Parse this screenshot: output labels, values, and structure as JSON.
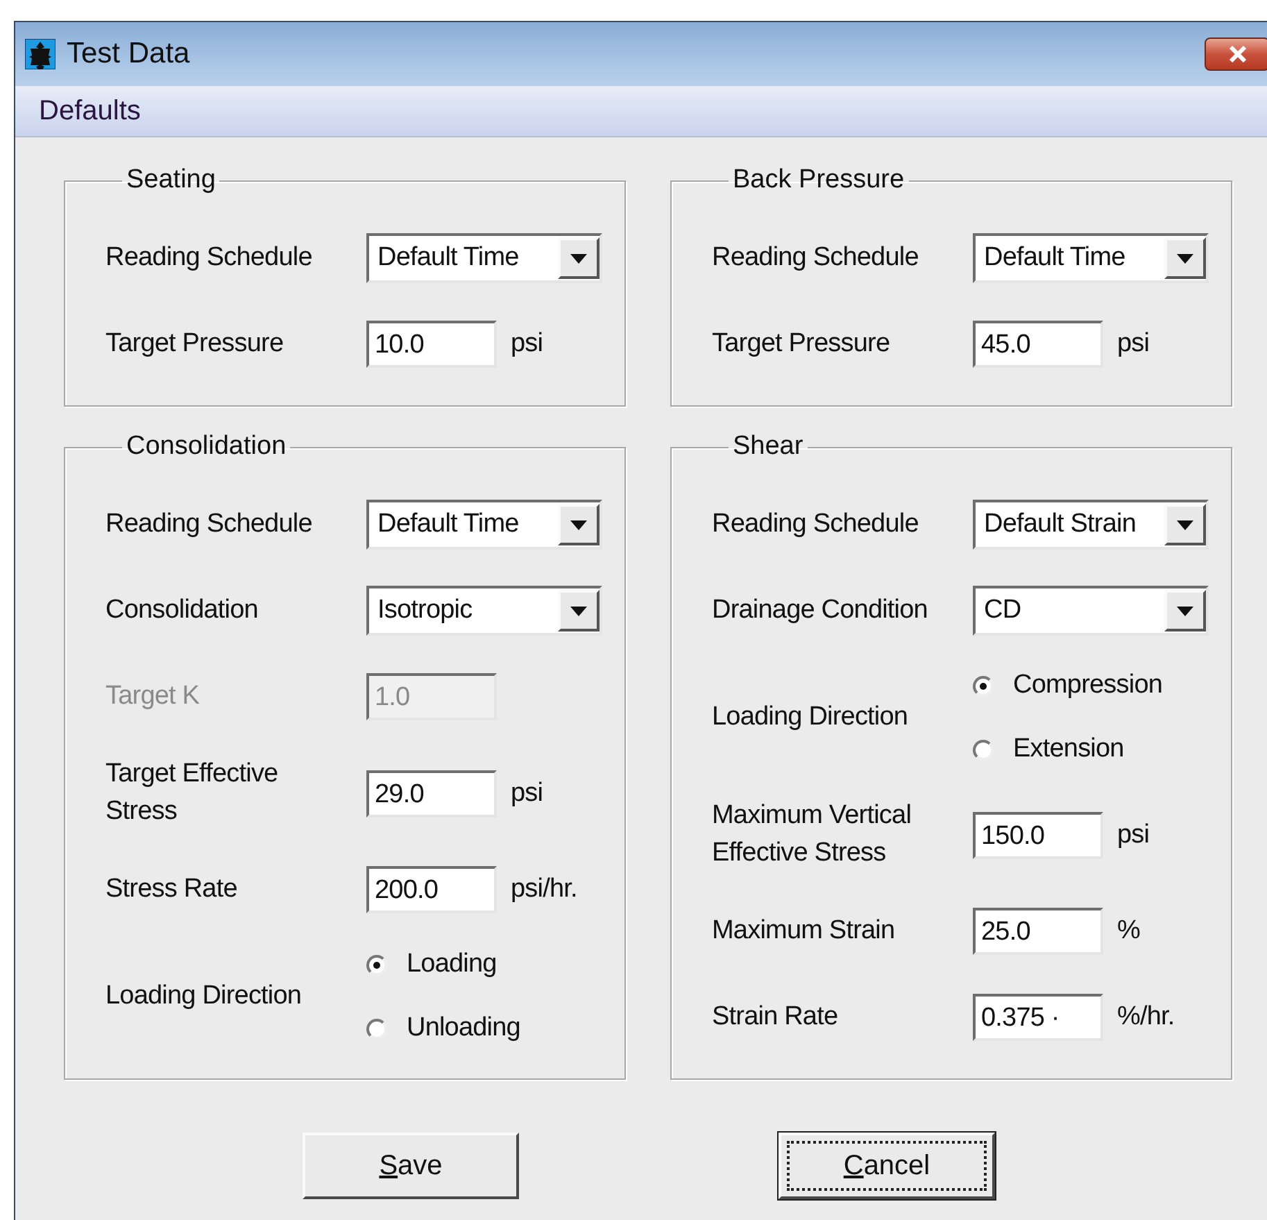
{
  "window": {
    "title": "Test Data"
  },
  "menu": [
    {
      "label": "Defaults"
    }
  ],
  "groups": [
    {
      "title": "Seating",
      "rows": [
        {
          "kind": "select",
          "label": "Reading Schedule",
          "value": "Default Time"
        },
        {
          "kind": "text",
          "label": "Target Pressure",
          "value": "10.0",
          "unit": "psi",
          "disabled": false
        }
      ]
    },
    {
      "title": "Back Pressure",
      "rows": [
        {
          "kind": "select",
          "label": "Reading Schedule",
          "value": "Default Time"
        },
        {
          "kind": "text",
          "label": "Target Pressure",
          "value": "45.0",
          "unit": "psi",
          "disabled": false
        }
      ]
    },
    {
      "title": "Consolidation",
      "rows": [
        {
          "kind": "select",
          "label": "Reading Schedule",
          "value": "Default Time"
        },
        {
          "kind": "select",
          "label": "Consolidation",
          "value": "Isotropic"
        },
        {
          "kind": "text",
          "label": "Target K",
          "value": "1.0",
          "disabled": true
        },
        {
          "kind": "text",
          "label": "Target Effective Stress",
          "value": "29.0",
          "unit": "psi",
          "disabled": false
        },
        {
          "kind": "text",
          "label": "Stress Rate",
          "value": "200.0",
          "unit": "psi/hr.",
          "disabled": false
        },
        {
          "kind": "radio",
          "label": "Loading Direction",
          "options": [
            {
              "label": "Loading",
              "selected": true
            },
            {
              "label": "Unloading",
              "selected": false
            }
          ]
        }
      ]
    },
    {
      "title": "Shear",
      "rows": [
        {
          "kind": "select",
          "label": "Reading Schedule",
          "value": "Default Strain"
        },
        {
          "kind": "select",
          "label": "Drainage Condition",
          "value": "CD"
        },
        {
          "kind": "radio",
          "label": "Loading Direction",
          "options": [
            {
              "label": "Compression",
              "selected": true
            },
            {
              "label": "Extension",
              "selected": false
            }
          ]
        },
        {
          "kind": "text",
          "label": "Maximum Vertical Effective Stress",
          "value": "150.0",
          "unit": "psi",
          "disabled": false
        },
        {
          "kind": "text",
          "label": "Maximum Strain",
          "value": "25.0",
          "unit": "%",
          "disabled": false
        },
        {
          "kind": "text",
          "label": "Strain Rate",
          "value": "0.375 ·",
          "unit": "%/hr.",
          "disabled": false
        }
      ]
    }
  ],
  "buttons": [
    {
      "label": "Save",
      "mnemonic": true,
      "focused": false
    },
    {
      "label": "Cancel",
      "mnemonic": true,
      "focused": true
    }
  ]
}
